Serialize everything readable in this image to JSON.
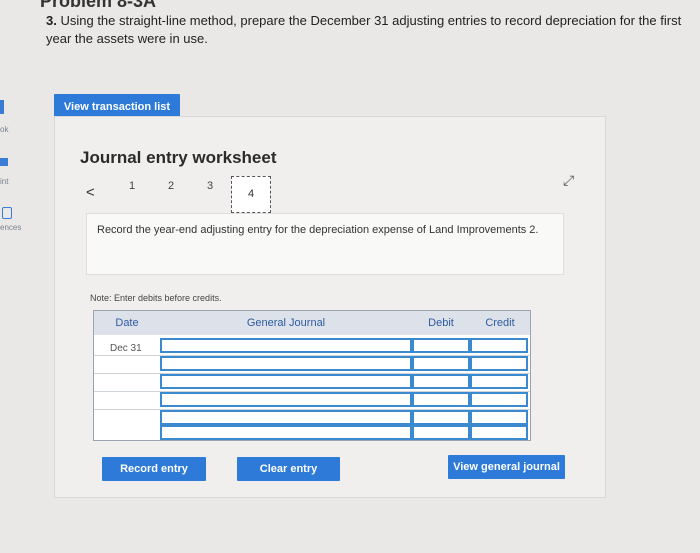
{
  "sidebar": {
    "items": [
      {
        "label": "ok"
      },
      {
        "label": "int"
      },
      {
        "label": "ences"
      }
    ]
  },
  "page": {
    "partial_title": "Problem 8-3A"
  },
  "question": {
    "number": "3.",
    "text": "Using the straight-line method, prepare the December 31 adjusting entries to record depreciation for the first year the assets were in use."
  },
  "buttons": {
    "view_transactions": "View transaction list",
    "record_entry": "Record entry",
    "clear_entry": "Clear entry",
    "view_general_journal": "View general journal"
  },
  "worksheet": {
    "title": "Journal entry worksheet",
    "pages": [
      "1",
      "2",
      "3",
      "4"
    ],
    "current_page": "4",
    "instruction": "Record the year-end adjusting entry for the depreciation expense of Land Improvements 2.",
    "note": "Note: Enter debits before credits."
  },
  "journal": {
    "headers": {
      "date": "Date",
      "general_journal": "General Journal",
      "debit": "Debit",
      "credit": "Credit"
    },
    "rows": [
      {
        "date": "Dec 31",
        "account": "",
        "debit": "",
        "credit": ""
      },
      {
        "date": "",
        "account": "",
        "debit": "",
        "credit": ""
      },
      {
        "date": "",
        "account": "",
        "debit": "",
        "credit": ""
      },
      {
        "date": "",
        "account": "",
        "debit": "",
        "credit": ""
      },
      {
        "date": "",
        "account": "",
        "debit": "",
        "credit": ""
      },
      {
        "date": "",
        "account": "",
        "debit": "",
        "credit": ""
      }
    ]
  },
  "colors": {
    "accent": "#2d7ad8",
    "input_border": "#3b8ad0",
    "header_bg": "#dde2ea"
  }
}
